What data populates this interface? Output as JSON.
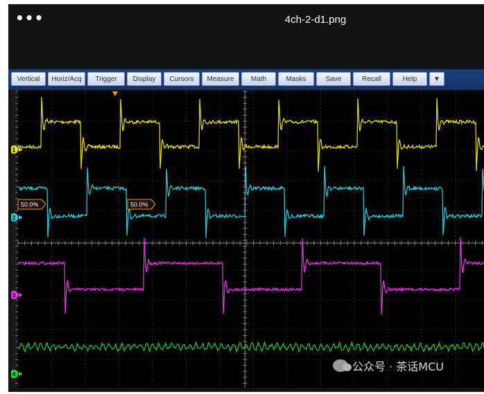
{
  "window": {
    "title": "4ch-2-d1.png",
    "menu_icon": "more-dots-icon"
  },
  "menu": {
    "items": [
      {
        "label": "Vertical"
      },
      {
        "label": "Horiz/Acq"
      },
      {
        "label": "Trigger"
      },
      {
        "label": "Display"
      },
      {
        "label": "Cursors"
      },
      {
        "label": "Measure"
      },
      {
        "label": "Math"
      },
      {
        "label": "Masks"
      },
      {
        "label": "Save"
      },
      {
        "label": "Recall"
      },
      {
        "label": "Help"
      },
      {
        "label": "▼"
      }
    ]
  },
  "scope": {
    "channels": [
      {
        "label": "1",
        "color": "#f2e600"
      },
      {
        "label": "2",
        "color": "#22d6e6"
      },
      {
        "label": "3",
        "color": "#ff2bff"
      },
      {
        "label": "4",
        "color": "#22e02a"
      }
    ],
    "threshold_markers": [
      "50.0%",
      "50.0%"
    ],
    "trigger_color": "#f2a100"
  },
  "watermark": {
    "text": "公众号 · 茶话MCU"
  }
}
